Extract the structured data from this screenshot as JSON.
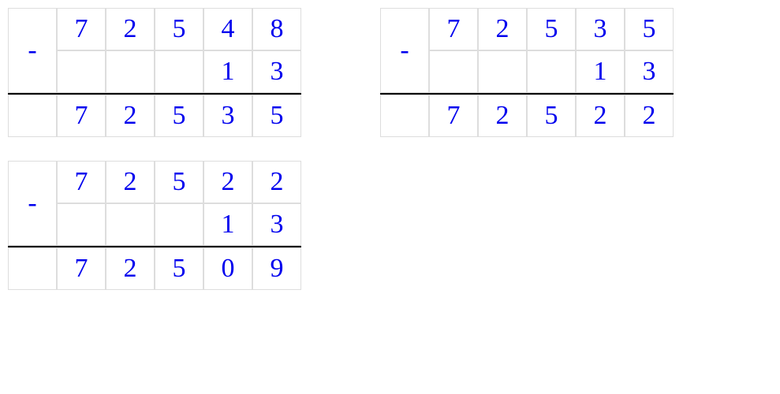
{
  "problems": [
    {
      "op": "-",
      "top": [
        "7",
        "2",
        "5",
        "4",
        "8"
      ],
      "bottom": [
        "",
        "",
        "",
        "1",
        "3"
      ],
      "result": [
        "7",
        "2",
        "5",
        "3",
        "5"
      ]
    },
    {
      "op": "-",
      "top": [
        "7",
        "2",
        "5",
        "3",
        "5"
      ],
      "bottom": [
        "",
        "",
        "",
        "1",
        "3"
      ],
      "result": [
        "7",
        "2",
        "5",
        "2",
        "2"
      ]
    },
    {
      "op": "-",
      "top": [
        "7",
        "2",
        "5",
        "2",
        "2"
      ],
      "bottom": [
        "",
        "",
        "",
        "1",
        "3"
      ],
      "result": [
        "7",
        "2",
        "5",
        "0",
        "9"
      ]
    }
  ]
}
